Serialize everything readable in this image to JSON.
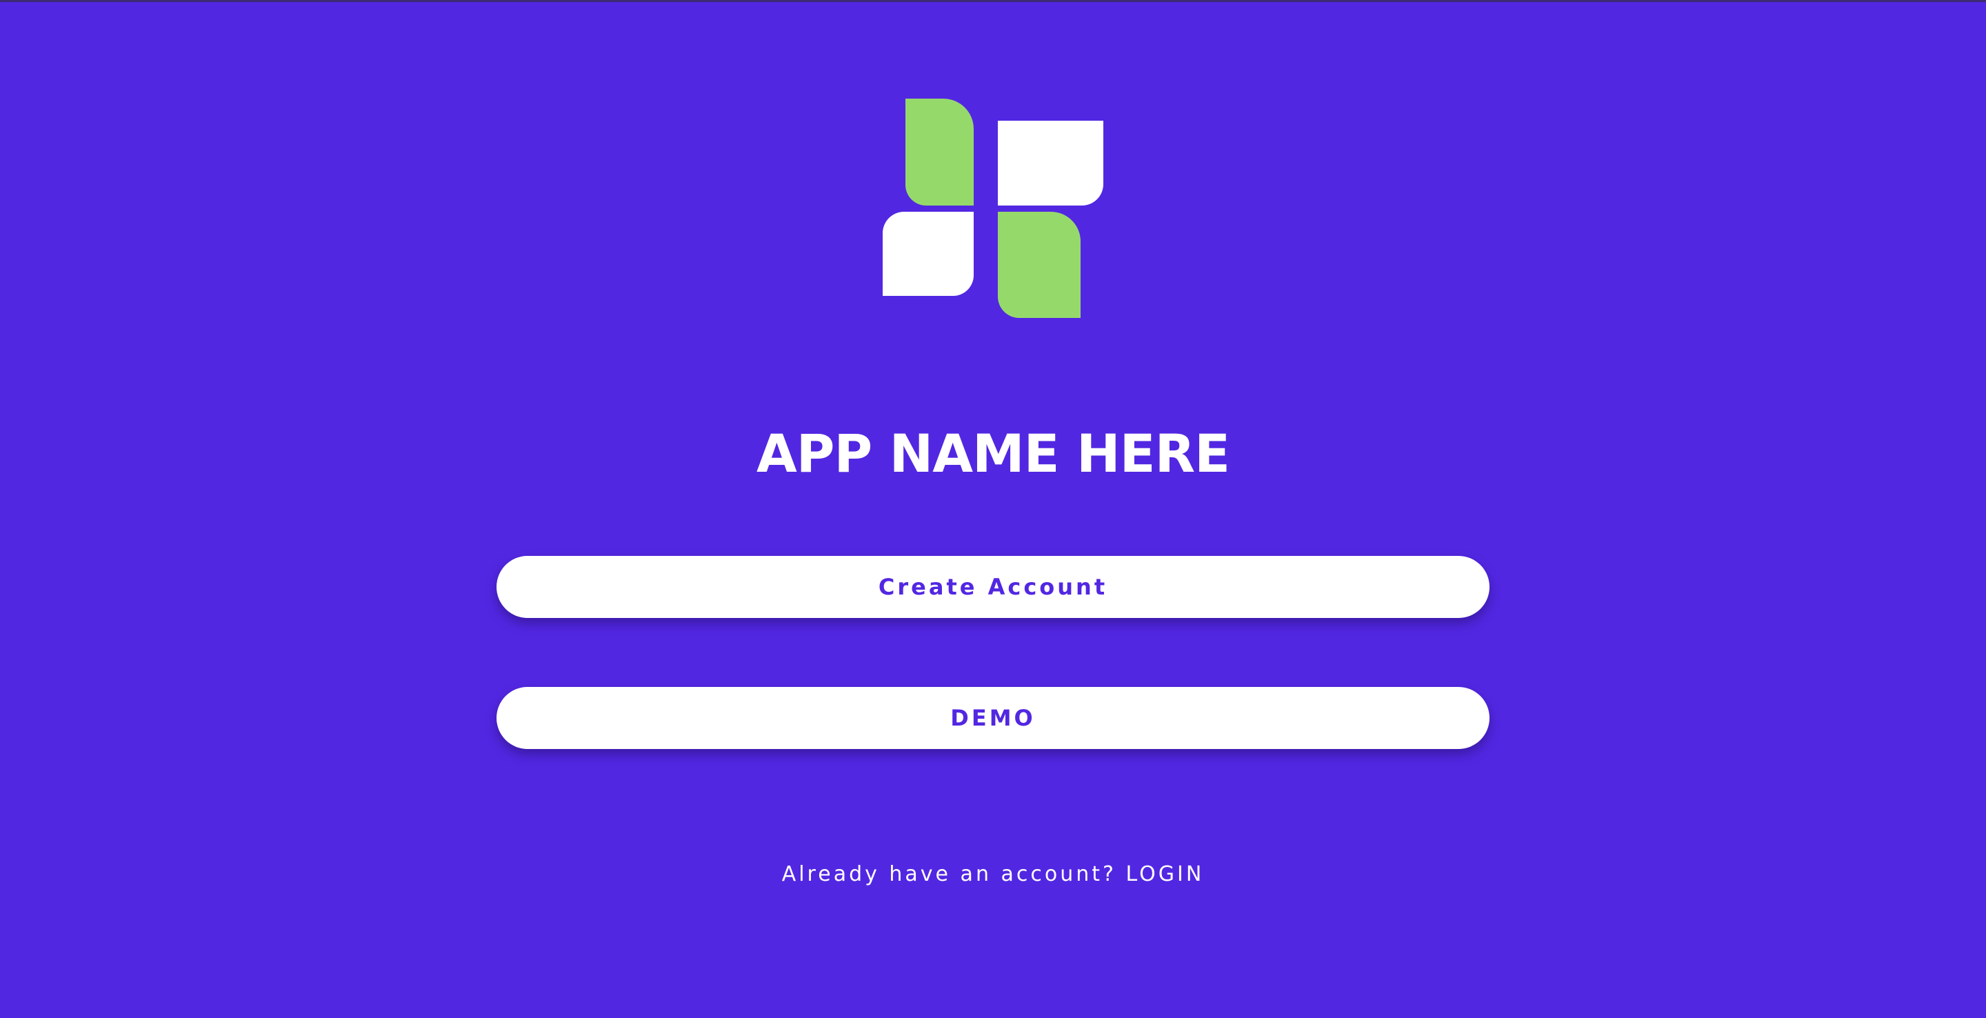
{
  "app": {
    "title": "APP NAME HERE"
  },
  "logo": {
    "icon": "four-leaf-logo-icon",
    "colors": {
      "green": "#96d96b",
      "white": "#ffffff"
    }
  },
  "buttons": {
    "create_account_label": "Create Account",
    "demo_label": "DEMO"
  },
  "login": {
    "prompt": "Already have an account?",
    "link_label": "LOGIN"
  },
  "colors": {
    "background": "#5227e2",
    "button_background": "#ffffff",
    "button_text": "#5227e2"
  }
}
